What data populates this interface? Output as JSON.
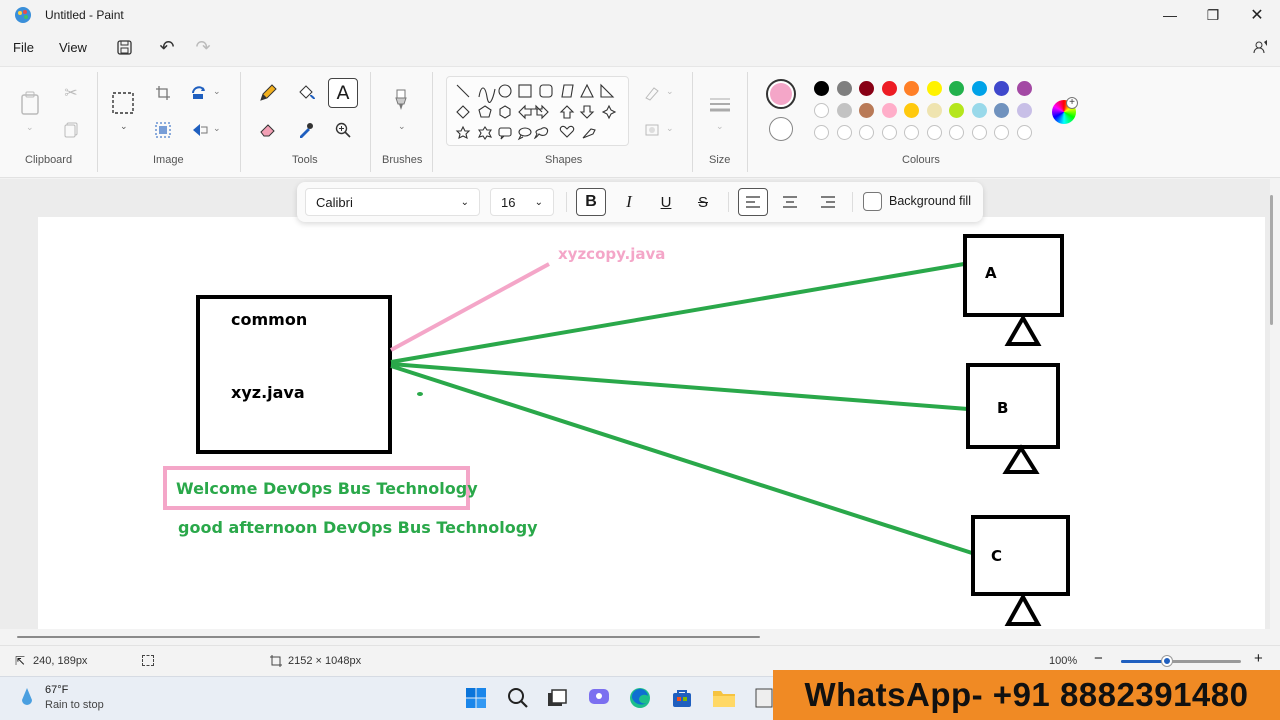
{
  "window": {
    "title": "Untitled - Paint"
  },
  "menu": {
    "file": "File",
    "view": "View"
  },
  "ribbon": {
    "groups": {
      "clipboard": "Clipboard",
      "image": "Image",
      "tools": "Tools",
      "brushes": "Brushes",
      "shapes": "Shapes",
      "size": "Size",
      "colours": "Colours"
    },
    "primary_color": "#f4a6c8",
    "secondary_color": "#ffffff",
    "palette_row1": [
      "#000000",
      "#7f7f7f",
      "#880015",
      "#ed1c24",
      "#ff7f27",
      "#fff200",
      "#22b14c",
      "#00a2e8",
      "#3f48cc",
      "#a349a4"
    ],
    "palette_row2": [
      "#ffffff",
      "#c3c3c3",
      "#b97a57",
      "#ffaec9",
      "#ffc90e",
      "#efe4b0",
      "#b5e61d",
      "#99d9ea",
      "#7092be",
      "#c8bfe7"
    ]
  },
  "textbar": {
    "font": "Calibri",
    "size": "16",
    "background_fill": "Background fill"
  },
  "canvas": {
    "box_label_common": "common",
    "box_label_file": "xyz.java",
    "copy_label": "xyzcopy.java",
    "welcome_text": "Welcome DevOps Bus Technology",
    "afternoon_text": "good afternoon DevOps Bus Technology",
    "node_a": "A",
    "node_b": "B",
    "node_c": "C",
    "green": "#2aa84a",
    "pink": "#f4a6c8"
  },
  "status": {
    "cursor_pos": "240, 189px",
    "canvas_size": "2152 × 1048px",
    "zoom": "100%"
  },
  "taskbar": {
    "temperature": "67°F",
    "weather": "Rain to stop"
  },
  "banner": {
    "text": "WhatsApp- +91 8882391480"
  }
}
